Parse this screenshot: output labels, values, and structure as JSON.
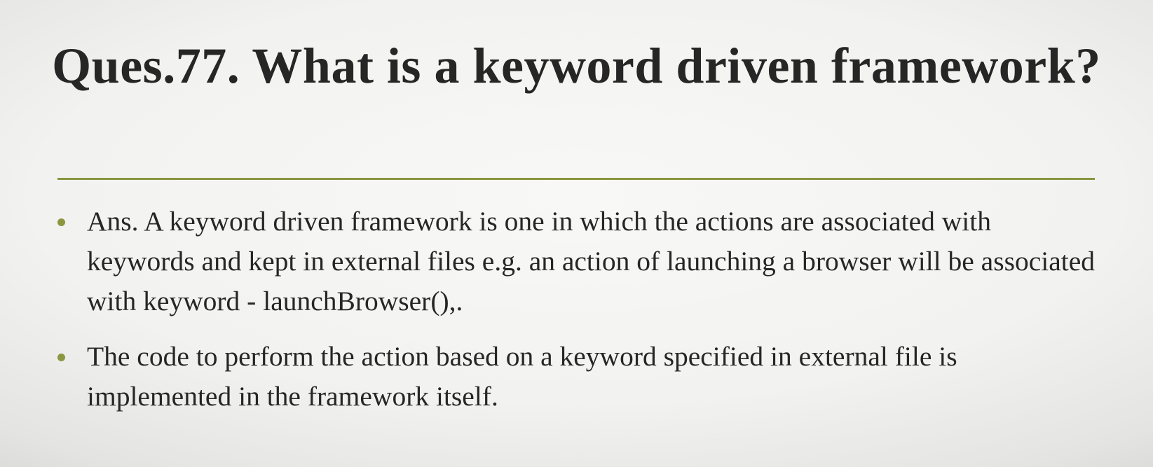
{
  "slide": {
    "title": "Ques.77. What is a keyword driven framework?",
    "accent_color": "#8b9640",
    "bullets": [
      {
        "text": "Ans. A keyword driven framework is one in which the actions are associated with keywords and kept in external files e.g. an action of launching a browser will be associated with keyword - launchBrowser(),."
      },
      {
        "text": "The code to perform the action based on a keyword specified in external file is implemented in the framework itself."
      }
    ]
  }
}
